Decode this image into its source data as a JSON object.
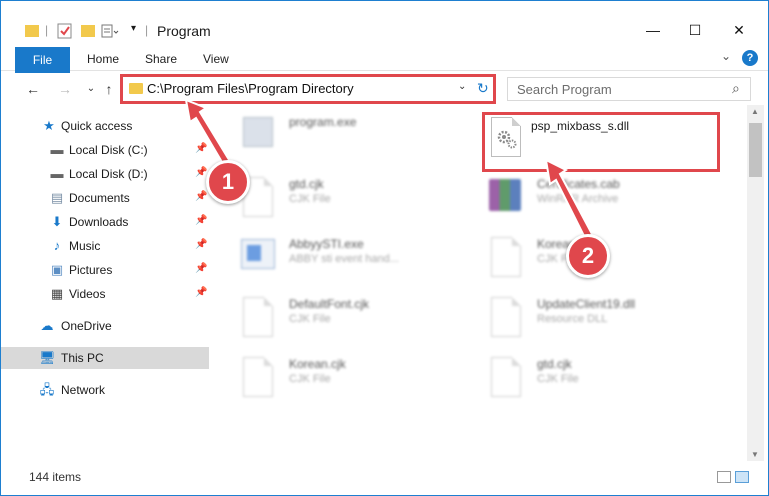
{
  "window": {
    "title": "Program"
  },
  "ribbon": {
    "file": "File",
    "tabs": [
      "Home",
      "Share",
      "View"
    ]
  },
  "address": {
    "path": "C:\\Program Files\\Program Directory"
  },
  "search": {
    "placeholder": "Search Program"
  },
  "nav": {
    "items": [
      {
        "label": "Quick access",
        "icon": "star-icon",
        "pinned": false
      },
      {
        "label": "Local Disk (C:)",
        "icon": "drive-icon",
        "pinned": true
      },
      {
        "label": "Local Disk (D:)",
        "icon": "drive-icon",
        "pinned": true
      },
      {
        "label": "Documents",
        "icon": "documents-icon",
        "pinned": true
      },
      {
        "label": "Downloads",
        "icon": "download-icon",
        "pinned": true
      },
      {
        "label": "Music",
        "icon": "music-icon",
        "pinned": true
      },
      {
        "label": "Pictures",
        "icon": "pictures-icon",
        "pinned": true
      },
      {
        "label": "Videos",
        "icon": "videos-icon",
        "pinned": true
      },
      {
        "label": "OneDrive",
        "icon": "cloud-icon",
        "pinned": false
      },
      {
        "label": "This PC",
        "icon": "computer-icon",
        "pinned": false
      },
      {
        "label": "Network",
        "icon": "network-icon",
        "pinned": false
      }
    ]
  },
  "files": {
    "highlighted": {
      "name": "psp_mixbass_s.dll"
    },
    "blurred": [
      {
        "name": "program.exe",
        "type": ""
      },
      {
        "name": "gtd.cjk",
        "type": "CJK File"
      },
      {
        "name": "Certificates.cab",
        "type": "WinRAR Archive"
      },
      {
        "name": "AbbyySTI.exe",
        "type": "ABBY sti event hand..."
      },
      {
        "name": "Korean.cjk",
        "type": "CJK File"
      },
      {
        "name": "DefaultFont.cjk",
        "type": "CJK File"
      },
      {
        "name": "UpdateClient19.dll",
        "type": "Resource DLL"
      },
      {
        "name": "Korean.cjk",
        "type": "CJK File"
      },
      {
        "name": "gtd.cjk",
        "type": "CJK File"
      }
    ]
  },
  "status": {
    "count": "144 items"
  },
  "annotations": {
    "step1": "1",
    "step2": "2"
  },
  "colors": {
    "accent": "#1979ca",
    "highlight": "#e0474c"
  }
}
